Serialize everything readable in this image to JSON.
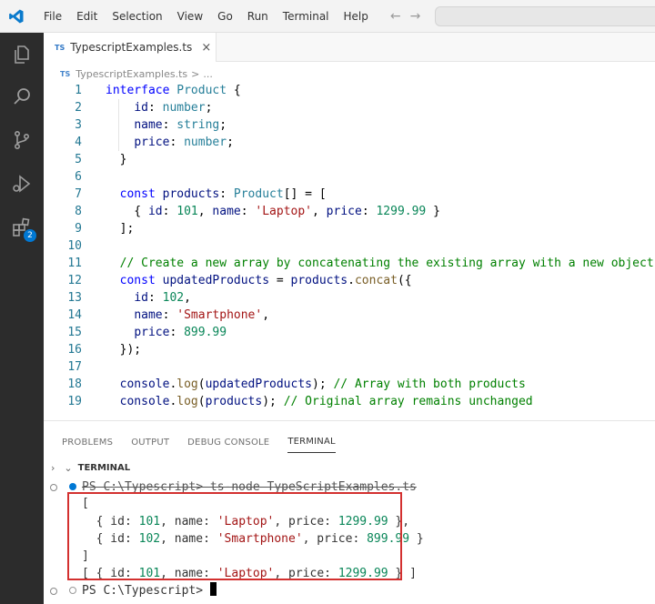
{
  "menu": [
    "File",
    "Edit",
    "Selection",
    "View",
    "Go",
    "Run",
    "Terminal",
    "Help"
  ],
  "tab": {
    "badge": "TS",
    "label": "TypescriptExamples.ts",
    "close": "×"
  },
  "breadcrumb": {
    "badge": "TS",
    "file": "TypescriptExamples.ts",
    "sep": ">",
    "more": "..."
  },
  "activity_badge": "2",
  "code_lines": [
    [
      [
        "kw",
        "interface "
      ],
      [
        "ty",
        "Product"
      ],
      [
        "pl",
        " {"
      ]
    ],
    [
      [
        "pl",
        "    "
      ],
      [
        "pr",
        "id"
      ],
      [
        "pl",
        ": "
      ],
      [
        "ty",
        "number"
      ],
      [
        "pl",
        ";"
      ]
    ],
    [
      [
        "pl",
        "    "
      ],
      [
        "pr",
        "name"
      ],
      [
        "pl",
        ": "
      ],
      [
        "ty",
        "string"
      ],
      [
        "pl",
        ";"
      ]
    ],
    [
      [
        "pl",
        "    "
      ],
      [
        "pr",
        "price"
      ],
      [
        "pl",
        ": "
      ],
      [
        "ty",
        "number"
      ],
      [
        "pl",
        ";"
      ]
    ],
    [
      [
        "pl",
        "  }"
      ]
    ],
    [
      [
        "pl",
        ""
      ]
    ],
    [
      [
        "pl",
        "  "
      ],
      [
        "kw",
        "const "
      ],
      [
        "pr",
        "products"
      ],
      [
        "pl",
        ": "
      ],
      [
        "ty",
        "Product"
      ],
      [
        "pl",
        "[] = ["
      ]
    ],
    [
      [
        "pl",
        "    { "
      ],
      [
        "pr",
        "id"
      ],
      [
        "pl",
        ": "
      ],
      [
        "num",
        "101"
      ],
      [
        "pl",
        ", "
      ],
      [
        "pr",
        "name"
      ],
      [
        "pl",
        ": "
      ],
      [
        "str",
        "'Laptop'"
      ],
      [
        "pl",
        ", "
      ],
      [
        "pr",
        "price"
      ],
      [
        "pl",
        ": "
      ],
      [
        "num",
        "1299.99"
      ],
      [
        "pl",
        " }"
      ]
    ],
    [
      [
        "pl",
        "  ];"
      ]
    ],
    [
      [
        "pl",
        ""
      ]
    ],
    [
      [
        "pl",
        "  "
      ],
      [
        "cm",
        "// Create a new array by concatenating the existing array with a new object"
      ]
    ],
    [
      [
        "pl",
        "  "
      ],
      [
        "kw",
        "const "
      ],
      [
        "pr",
        "updatedProducts"
      ],
      [
        "pl",
        " = "
      ],
      [
        "pr",
        "products"
      ],
      [
        "pl",
        "."
      ],
      [
        "fn",
        "concat"
      ],
      [
        "pl",
        "({"
      ]
    ],
    [
      [
        "pl",
        "    "
      ],
      [
        "pr",
        "id"
      ],
      [
        "pl",
        ": "
      ],
      [
        "num",
        "102"
      ],
      [
        "pl",
        ","
      ]
    ],
    [
      [
        "pl",
        "    "
      ],
      [
        "pr",
        "name"
      ],
      [
        "pl",
        ": "
      ],
      [
        "str",
        "'Smartphone'"
      ],
      [
        "pl",
        ","
      ]
    ],
    [
      [
        "pl",
        "    "
      ],
      [
        "pr",
        "price"
      ],
      [
        "pl",
        ": "
      ],
      [
        "num",
        "899.99"
      ]
    ],
    [
      [
        "pl",
        "  });"
      ]
    ],
    [
      [
        "pl",
        ""
      ]
    ],
    [
      [
        "pl",
        "  "
      ],
      [
        "pr",
        "console"
      ],
      [
        "pl",
        "."
      ],
      [
        "fn",
        "log"
      ],
      [
        "pl",
        "("
      ],
      [
        "pr",
        "updatedProducts"
      ],
      [
        "pl",
        "); "
      ],
      [
        "cm",
        "// Array with both products"
      ]
    ],
    [
      [
        "pl",
        "  "
      ],
      [
        "pr",
        "console"
      ],
      [
        "pl",
        "."
      ],
      [
        "fn",
        "log"
      ],
      [
        "pl",
        "("
      ],
      [
        "pr",
        "products"
      ],
      [
        "pl",
        "); "
      ],
      [
        "cm",
        "// Original array remains unchanged"
      ]
    ]
  ],
  "panel_tabs": [
    "PROBLEMS",
    "OUTPUT",
    "DEBUG CONSOLE",
    "TERMINAL"
  ],
  "terminal_header": "TERMINAL",
  "terminal_lines": [
    [
      [
        "strike",
        "PS C:\\Typescript> ts-node TypeScriptExamples.ts"
      ]
    ],
    [
      [
        "p",
        "["
      ]
    ],
    [
      [
        "p",
        "  { id: "
      ],
      [
        "n",
        "101"
      ],
      [
        "p",
        ", name: "
      ],
      [
        "s",
        "'Laptop'"
      ],
      [
        "p",
        ", price: "
      ],
      [
        "n",
        "1299.99"
      ],
      [
        "p",
        " },"
      ]
    ],
    [
      [
        "p",
        "  { id: "
      ],
      [
        "n",
        "102"
      ],
      [
        "p",
        ", name: "
      ],
      [
        "s",
        "'Smartphone'"
      ],
      [
        "p",
        ", price: "
      ],
      [
        "n",
        "899.99"
      ],
      [
        "p",
        " }"
      ]
    ],
    [
      [
        "p",
        "]"
      ]
    ],
    [
      [
        "p",
        "[ { id: "
      ],
      [
        "n",
        "101"
      ],
      [
        "p",
        ", name: "
      ],
      [
        "s",
        "'Laptop'"
      ],
      [
        "p",
        ", price: "
      ],
      [
        "n",
        "1299.99"
      ],
      [
        "p",
        " } ]"
      ]
    ],
    [
      [
        "p",
        "PS C:\\Typescript> "
      ]
    ]
  ],
  "colors": {
    "activity_bar": "#2c2c2c",
    "accent": "#0078d4",
    "highlight_box": "#d3302f"
  }
}
